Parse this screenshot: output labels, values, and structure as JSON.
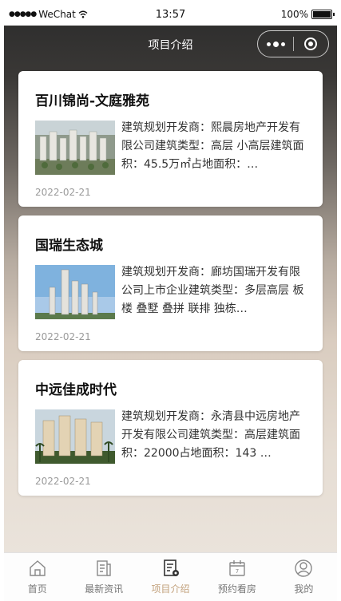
{
  "status_bar": {
    "carrier": "WeChat",
    "time": "13:57",
    "battery": "100%"
  },
  "nav": {
    "title": "项目介绍"
  },
  "projects": [
    {
      "title": "百川锦尚-文庭雅苑",
      "description": "建筑规划开发商：熙晨房地产开发有限公司建筑类型：高层 小高层建筑面积：45.5万㎡占地面积：…",
      "date": "2022-02-21",
      "thumb": "building-model"
    },
    {
      "title": "国瑞生态城",
      "description": "建筑规划开发商：廊坊国瑞开发有限公司上市企业建筑类型：多层高层 板楼 叠墅 叠拼 联排 独栋…",
      "date": "2022-02-21",
      "thumb": "towers-sky"
    },
    {
      "title": "中远佳成时代",
      "description": "建筑规划开发商：永清县中远房地产开发有限公司建筑类型：高层建筑面积：22000占地面积：143 …",
      "date": "2022-02-21",
      "thumb": "residential-palms"
    }
  ],
  "tabs": [
    {
      "label": "首页",
      "icon": "home-icon",
      "active": false
    },
    {
      "label": "最新资讯",
      "icon": "news-icon",
      "active": false
    },
    {
      "label": "项目介绍",
      "icon": "project-icon",
      "active": true
    },
    {
      "label": "预约看房",
      "icon": "calendar-icon",
      "active": false
    },
    {
      "label": "我的",
      "icon": "profile-icon",
      "active": false
    }
  ],
  "colors": {
    "accent": "#c2a17c",
    "nav_bg": "#2b2b2b"
  }
}
